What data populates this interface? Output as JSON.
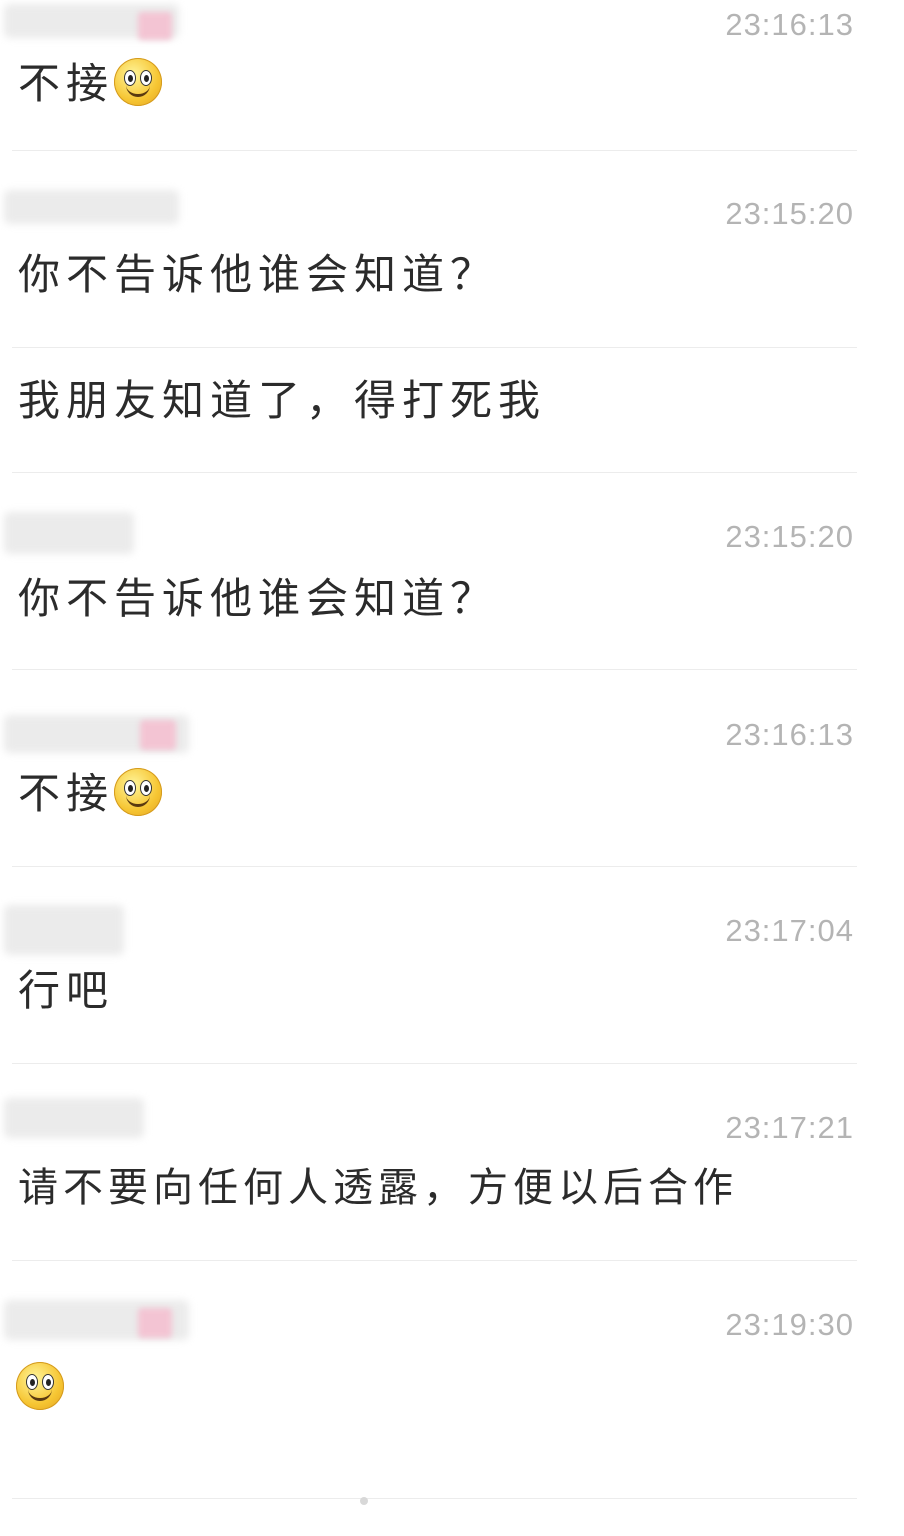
{
  "messages": [
    {
      "time": "23:16:13",
      "text": "不接",
      "emoji": "smile-emoji"
    },
    {
      "time": "23:15:20",
      "text": "你不告诉他谁会知道？"
    },
    {
      "text": "我朋友知道了，得打死我"
    },
    {
      "time": "23:15:20",
      "text": "你不告诉他谁会知道？"
    },
    {
      "time": "23:16:13",
      "text": "不接",
      "emoji": "smile-emoji"
    },
    {
      "time": "23:17:04",
      "text": "行吧"
    },
    {
      "time": "23:17:21",
      "text": "请不要向任何人透露，方便以后合作"
    },
    {
      "time": "23:19:30",
      "text": "",
      "emoji": "smile-emoji"
    }
  ],
  "colors": {
    "timestamp": "#b4b4b4",
    "text": "#2b2b2b",
    "separator": "#ececec",
    "blur": "#ebebeb",
    "blur_accent": "#f3c4d3"
  }
}
